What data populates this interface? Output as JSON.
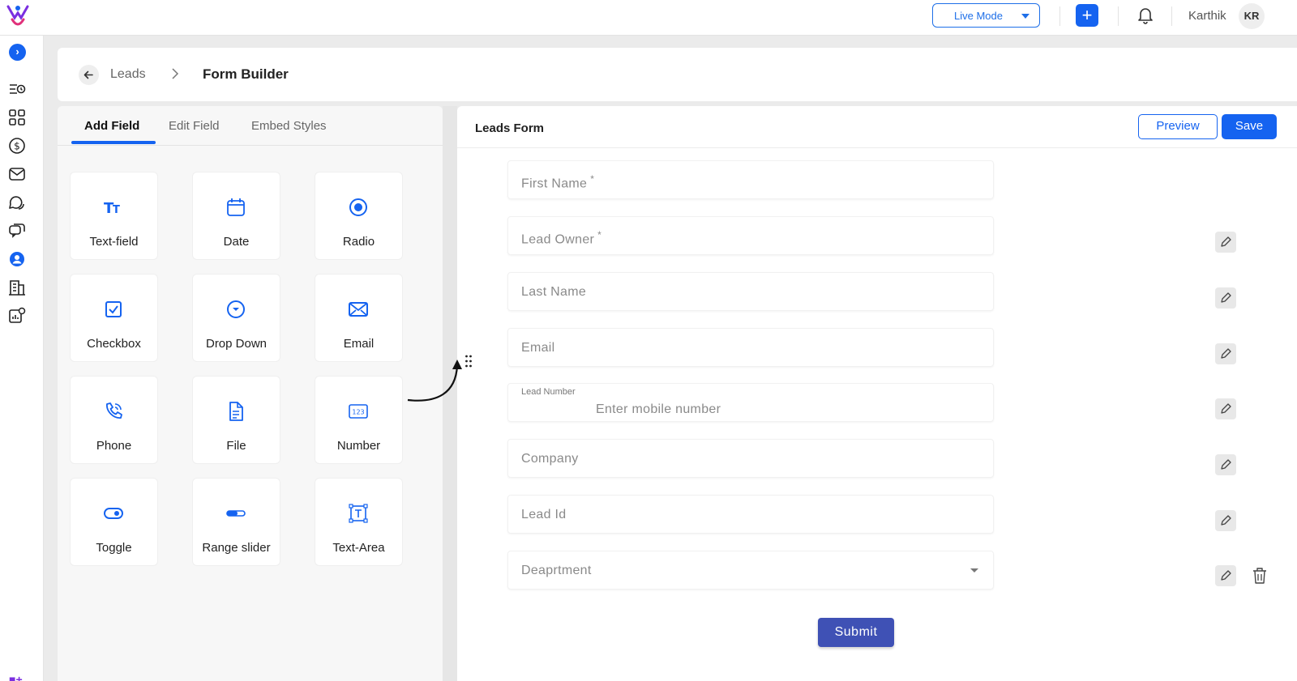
{
  "topbar": {
    "mode_label": "Live Mode",
    "add_label": "+",
    "user_name": "Karthik",
    "user_initials": "KR"
  },
  "sidebar": {
    "toggle_label": "›",
    "items": [
      "menu-clock",
      "dashboard",
      "dollar",
      "mail",
      "chat",
      "message",
      "contacts",
      "building",
      "analytics-settings"
    ],
    "bottom_label": "■+"
  },
  "breadcrumb": {
    "parent": "Leads",
    "current": "Form Builder"
  },
  "tabs": [
    {
      "label": "Add Field",
      "active": true
    },
    {
      "label": "Edit Field",
      "active": false
    },
    {
      "label": "Embed Styles",
      "active": false
    }
  ],
  "field_types": [
    {
      "label": "Text-field",
      "icon": "text-field-icon"
    },
    {
      "label": "Date",
      "icon": "calendar-icon"
    },
    {
      "label": "Radio",
      "icon": "radio-icon"
    },
    {
      "label": "Checkbox",
      "icon": "checkbox-icon"
    },
    {
      "label": "Drop Down",
      "icon": "dropdown-icon"
    },
    {
      "label": "Email",
      "icon": "email-icon"
    },
    {
      "label": "Phone",
      "icon": "phone-icon"
    },
    {
      "label": "File",
      "icon": "file-icon"
    },
    {
      "label": "Number",
      "icon": "number-icon"
    },
    {
      "label": "Toggle",
      "icon": "toggle-icon"
    },
    {
      "label": "Range slider",
      "icon": "range-slider-icon"
    },
    {
      "label": "Text-Area",
      "icon": "text-area-icon"
    }
  ],
  "form": {
    "title": "Leads Form",
    "preview_label": "Preview",
    "save_label": "Save",
    "submit_label": "Submit",
    "fields": [
      {
        "placeholder": "First Name",
        "required": "*"
      },
      {
        "placeholder": "Lead Owner",
        "required": "*"
      },
      {
        "placeholder": "Last Name"
      },
      {
        "placeholder": "Email"
      },
      {
        "label": "Lead Number",
        "placeholder": "Enter mobile number"
      },
      {
        "placeholder": "Company"
      },
      {
        "placeholder": "Lead Id"
      },
      {
        "placeholder": "Deaprtment"
      }
    ]
  },
  "colors": {
    "accent": "#1563f0",
    "submit": "#3f51b5"
  }
}
